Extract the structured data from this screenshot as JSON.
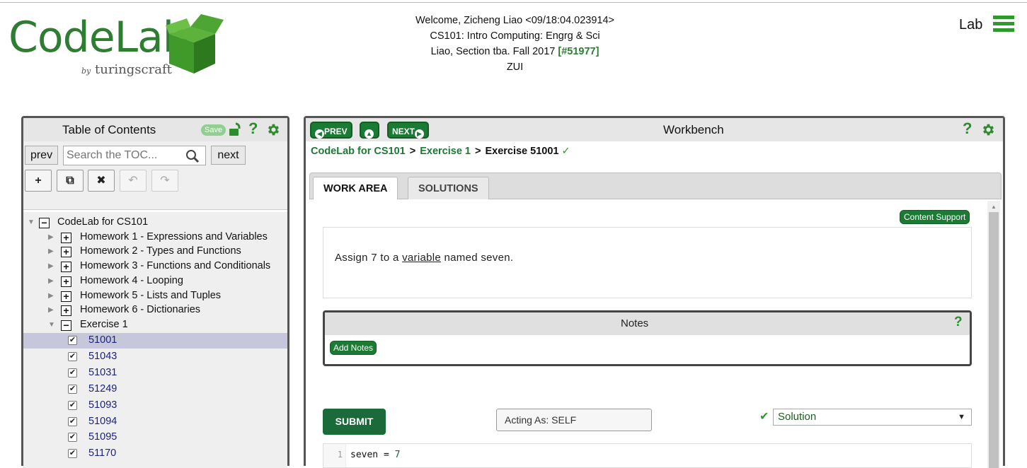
{
  "header": {
    "logo_text": "CodeLab",
    "logo_by": "by",
    "logo_sub": "turingscraft",
    "welcome": "Welcome, Zicheng Liao <09/18:04.023914>",
    "course": "CS101: Intro Computing: Engrg & Sci",
    "section": "Liao, Section tba. Fall 2017",
    "section_id": "[#51977]",
    "zui": "ZUI",
    "lab_label": "Lab"
  },
  "toc": {
    "title": "Table of Contents",
    "save": "Save",
    "prev": "prev",
    "next": "next",
    "search_placeholder": "Search the TOC...",
    "tools": [
      "+",
      "⧉",
      "✖",
      "↶",
      "↷"
    ],
    "root": "CodeLab for CS101",
    "folders": [
      "Homework 1 - Expressions and Variables",
      "Homework 2 - Types and Functions",
      "Homework 3 - Functions and Conditionals",
      "Homework 4 - Looping",
      "Homework 5 - Lists and Tuples",
      "Homework 6 - Dictionaries",
      "Exercise 1"
    ],
    "exercises": [
      "51001",
      "51043",
      "51031",
      "51249",
      "51093",
      "51094",
      "51095",
      "51170"
    ]
  },
  "workbench": {
    "title": "Workbench",
    "prev": "PREV",
    "next": "NEXT",
    "breadcrumb": {
      "root": "CodeLab for CS101",
      "sep": ">",
      "section": "Exercise 1",
      "current": "Exercise 51001",
      "check": "✓"
    },
    "tabs": [
      "WORK AREA",
      "SOLUTIONS"
    ],
    "content_support": "Content Support",
    "prompt_before": "Assign 7 to a",
    "prompt_link": "variable",
    "prompt_after": "named seven.",
    "notes_title": "Notes",
    "add_notes": "Add Notes",
    "submit": "SUBMIT",
    "acting_as": "Acting As: SELF",
    "solution_select": "Solution",
    "code_line_number": "1",
    "code_var": "seven = ",
    "code_num": "7"
  },
  "colors": {
    "brand_green": "#1b7a33",
    "selected_row": "#c7c7dc"
  }
}
